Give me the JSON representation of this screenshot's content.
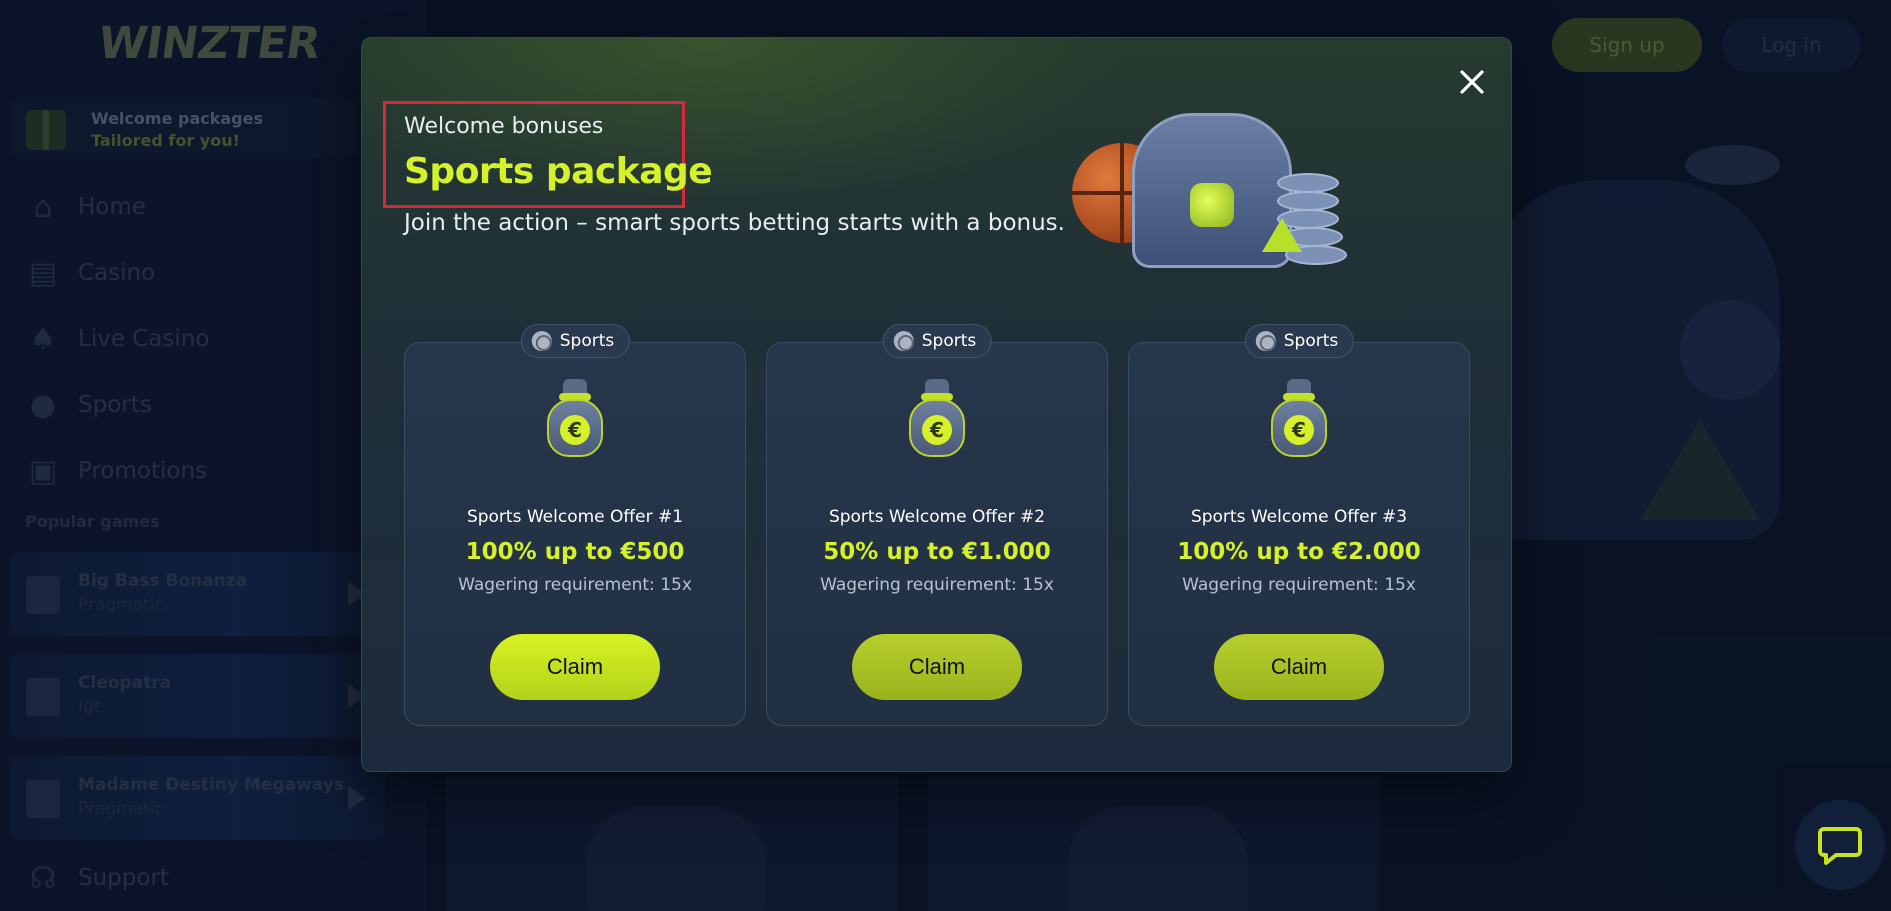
{
  "app": {
    "logo": "WINZTER",
    "welcome": {
      "title": "Welcome packages",
      "subtitle": "Tailored for you!"
    },
    "nav": [
      {
        "label": "Home",
        "icon": "home-icon"
      },
      {
        "label": "Casino",
        "icon": "slot-machine-icon"
      },
      {
        "label": "Live Casino",
        "icon": "cards-icon"
      },
      {
        "label": "Sports",
        "icon": "soccer-ball-icon"
      },
      {
        "label": "Promotions",
        "icon": "gift-icon"
      }
    ],
    "popular_label": "Popular games",
    "games": [
      {
        "name": "Big Bass Bonanza",
        "provider": "Pragmatic"
      },
      {
        "name": "Cleopatra",
        "provider": "Igt"
      },
      {
        "name": "Madame Destiny Megaways",
        "provider": "Pragmatic"
      }
    ],
    "support_label": "Support",
    "topbar": {
      "signup": "Sign up",
      "login": "Log in"
    }
  },
  "modal": {
    "eyebrow": "Welcome bonuses",
    "title": "Sports package",
    "description": "Join the action – smart sports betting starts with a bonus.",
    "close_icon": "close-icon",
    "offers": [
      {
        "badge": "Sports",
        "name": "Sports Welcome Offer #1",
        "amount": "100% up to €500",
        "wager": "Wagering requirement: 15x",
        "claim": "Claim"
      },
      {
        "badge": "Sports",
        "name": "Sports Welcome Offer #2",
        "amount": "50% up to €1.000",
        "wager": "Wagering requirement: 15x",
        "claim": "Claim"
      },
      {
        "badge": "Sports",
        "name": "Sports Welcome Offer #3",
        "amount": "100% up to €2.000",
        "wager": "Wagering requirement: 15x",
        "claim": "Claim"
      }
    ]
  },
  "colors": {
    "accent": "#d5f12a",
    "highlight": "#d42a3c",
    "background": "#0c1a2e"
  }
}
